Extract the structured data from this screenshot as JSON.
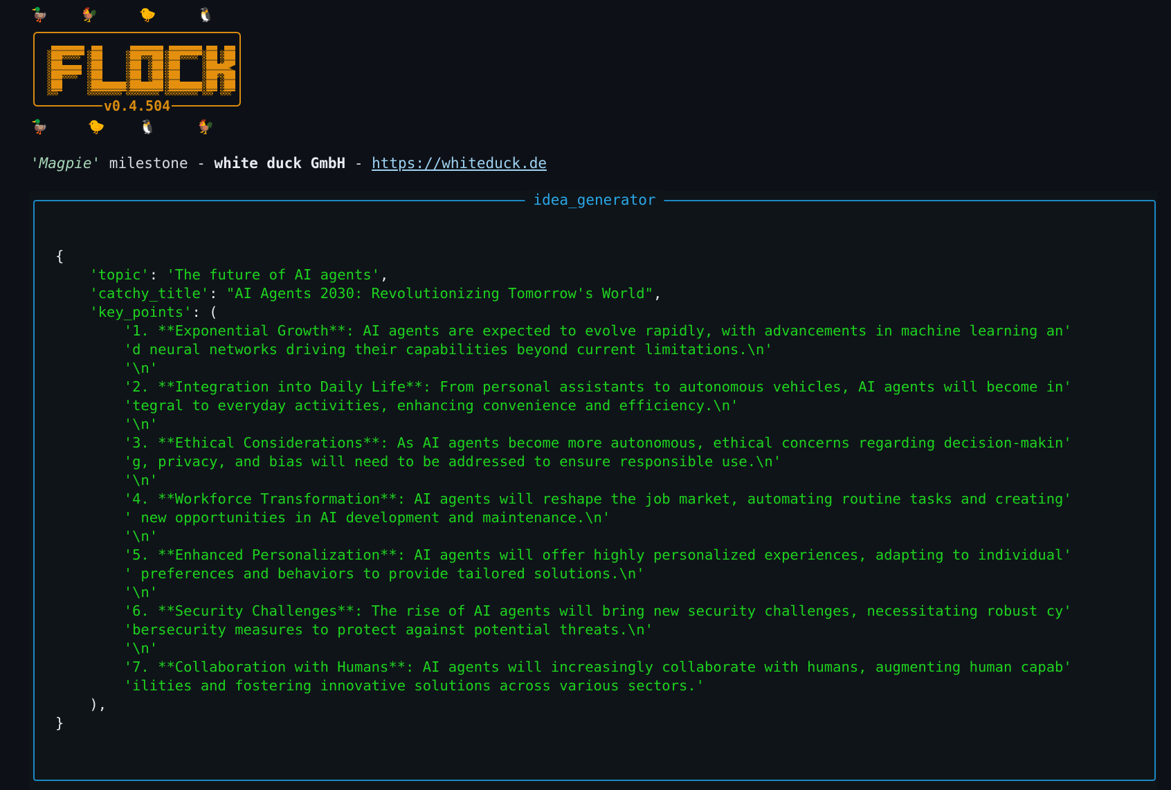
{
  "header": {
    "emoji_top": [
      "🦆",
      "🐓",
      "🐤",
      "🐧"
    ],
    "emoji_bottom": [
      "🦆",
      "🐤",
      "🐧",
      "🐓"
    ],
    "logo_text": "FLOCK",
    "version": "v0.4.504",
    "brand_color": "#d98a0f"
  },
  "subtitle": {
    "milestone": "'Magpie'",
    "milestone_suffix": " milestone - ",
    "company": "white duck GmbH",
    "separator": " - ",
    "link": "https://whiteduck.de"
  },
  "panel": {
    "title": "idea_generator",
    "border_color": "#1b8ac4",
    "lines": [
      {
        "indent": 0,
        "parts": [
          {
            "t": "{",
            "c": "punct"
          }
        ]
      },
      {
        "indent": 1,
        "parts": [
          {
            "t": "'topic'",
            "c": "key"
          },
          {
            "t": ": ",
            "c": "punct"
          },
          {
            "t": "'The future of AI agents'",
            "c": "str"
          },
          {
            "t": ",",
            "c": "punct"
          }
        ]
      },
      {
        "indent": 1,
        "parts": [
          {
            "t": "'catchy_title'",
            "c": "key"
          },
          {
            "t": ": ",
            "c": "punct"
          },
          {
            "t": "\"AI Agents 2030: Revolutionizing Tomorrow's World\"",
            "c": "str"
          },
          {
            "t": ",",
            "c": "punct"
          }
        ]
      },
      {
        "indent": 1,
        "parts": [
          {
            "t": "'key_points'",
            "c": "key"
          },
          {
            "t": ": (",
            "c": "punct"
          }
        ]
      },
      {
        "indent": 2,
        "parts": [
          {
            "t": "'1. **Exponential Growth**: AI agents are expected to evolve rapidly, with advancements in machine learning an'",
            "c": "str"
          }
        ]
      },
      {
        "indent": 2,
        "parts": [
          {
            "t": "'d neural networks driving their capabilities beyond current limitations.\\n'",
            "c": "str"
          }
        ]
      },
      {
        "indent": 2,
        "parts": [
          {
            "t": "'\\n'",
            "c": "str"
          }
        ]
      },
      {
        "indent": 2,
        "parts": [
          {
            "t": "'2. **Integration into Daily Life**: From personal assistants to autonomous vehicles, AI agents will become in'",
            "c": "str"
          }
        ]
      },
      {
        "indent": 2,
        "parts": [
          {
            "t": "'tegral to everyday activities, enhancing convenience and efficiency.\\n'",
            "c": "str"
          }
        ]
      },
      {
        "indent": 2,
        "parts": [
          {
            "t": "'\\n'",
            "c": "str"
          }
        ]
      },
      {
        "indent": 2,
        "parts": [
          {
            "t": "'3. **Ethical Considerations**: As AI agents become more autonomous, ethical concerns regarding decision-makin'",
            "c": "str"
          }
        ]
      },
      {
        "indent": 2,
        "parts": [
          {
            "t": "'g, privacy, and bias will need to be addressed to ensure responsible use.\\n'",
            "c": "str"
          }
        ]
      },
      {
        "indent": 2,
        "parts": [
          {
            "t": "'\\n'",
            "c": "str"
          }
        ]
      },
      {
        "indent": 2,
        "parts": [
          {
            "t": "'4. **Workforce Transformation**: AI agents will reshape the job market, automating routine tasks and creating'",
            "c": "str"
          }
        ]
      },
      {
        "indent": 2,
        "parts": [
          {
            "t": "' new opportunities in AI development and maintenance.\\n'",
            "c": "str"
          }
        ]
      },
      {
        "indent": 2,
        "parts": [
          {
            "t": "'\\n'",
            "c": "str"
          }
        ]
      },
      {
        "indent": 2,
        "parts": [
          {
            "t": "'5. **Enhanced Personalization**: AI agents will offer highly personalized experiences, adapting to individual'",
            "c": "str"
          }
        ]
      },
      {
        "indent": 2,
        "parts": [
          {
            "t": "' preferences and behaviors to provide tailored solutions.\\n'",
            "c": "str"
          }
        ]
      },
      {
        "indent": 2,
        "parts": [
          {
            "t": "'\\n'",
            "c": "str"
          }
        ]
      },
      {
        "indent": 2,
        "parts": [
          {
            "t": "'6. **Security Challenges**: The rise of AI agents will bring new security challenges, necessitating robust cy'",
            "c": "str"
          }
        ]
      },
      {
        "indent": 2,
        "parts": [
          {
            "t": "'bersecurity measures to protect against potential threats.\\n'",
            "c": "str"
          }
        ]
      },
      {
        "indent": 2,
        "parts": [
          {
            "t": "'\\n'",
            "c": "str"
          }
        ]
      },
      {
        "indent": 2,
        "parts": [
          {
            "t": "'7. **Collaboration with Humans**: AI agents will increasingly collaborate with humans, augmenting human capab'",
            "c": "str"
          }
        ]
      },
      {
        "indent": 2,
        "parts": [
          {
            "t": "'ilities and fostering innovative solutions across various sectors.'",
            "c": "str"
          }
        ]
      },
      {
        "indent": 1,
        "parts": [
          {
            "t": "),",
            "c": "punct"
          }
        ]
      },
      {
        "indent": 0,
        "parts": [
          {
            "t": "}",
            "c": "punct"
          }
        ]
      }
    ]
  }
}
